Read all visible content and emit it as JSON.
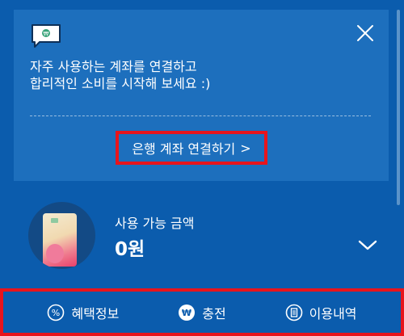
{
  "banner": {
    "message_line1": "자주 사용하는 계좌를 연결하고",
    "message_line2": "합리적인 소비를 시작해 보세요 :)",
    "connect_button": "은행 계좌 연결하기",
    "connect_chevron": ">",
    "icons": {
      "chat": "chat-bubble-icon",
      "close": "close-icon"
    }
  },
  "balance": {
    "label": "사용 가능 금액",
    "amount": "0원"
  },
  "bottom_nav": {
    "items": [
      {
        "label": "혜택정보",
        "icon": "percent-icon"
      },
      {
        "label": "충전",
        "icon": "won-icon"
      },
      {
        "label": "이용내역",
        "icon": "receipt-icon"
      }
    ]
  },
  "colors": {
    "background": "#0b5cad",
    "card": "#1d6fbd",
    "highlight_border": "#e8141c",
    "text": "#ffffff"
  }
}
